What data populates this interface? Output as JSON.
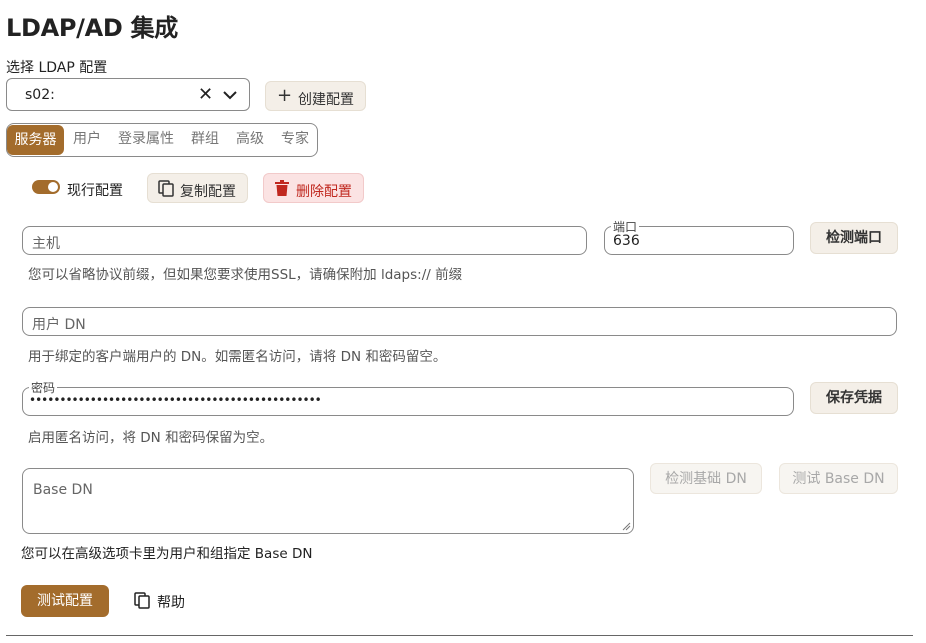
{
  "page": {
    "title": "LDAP/AD 集成"
  },
  "config_select": {
    "label": "选择 LDAP 配置",
    "value": "s02:",
    "clear_icon": "close-icon",
    "dropdown_icon": "chevron-down-icon"
  },
  "create_button": {
    "label": "创建配置",
    "icon": "plus-icon"
  },
  "tabs": [
    {
      "label": "服务器",
      "active": true
    },
    {
      "label": "用户",
      "active": false
    },
    {
      "label": "登录属性",
      "active": false
    },
    {
      "label": "群组",
      "active": false
    },
    {
      "label": "高级",
      "active": false
    },
    {
      "label": "专家",
      "active": false
    }
  ],
  "config_actions": {
    "active_toggle": {
      "label": "现行配置",
      "on": true
    },
    "copy": {
      "label": "复制配置",
      "icon": "copy-icon"
    },
    "delete": {
      "label": "删除配置",
      "icon": "trash-icon"
    }
  },
  "server": {
    "host": {
      "placeholder": "主机",
      "value": ""
    },
    "port": {
      "legend": "端口",
      "value": "636"
    },
    "detect_port": "检测端口",
    "host_help": "您可以省略协议前缀，但如果您要求使用SSL，请确保附加 ldaps:// 前缀"
  },
  "user_dn": {
    "placeholder": "用户 DN",
    "value": "",
    "help": "用于绑定的客户端用户的 DN。如需匿名访问，请将 DN 和密码留空。"
  },
  "password": {
    "legend": "密码",
    "value": "••••••••••••••••••••••••••••••••••••••••••••••••",
    "save": "保存凭据",
    "help": "启用匿名访问，将 DN 和密码保留为空。"
  },
  "base_dn": {
    "placeholder": "Base DN",
    "value": "",
    "detect": "检测基础 DN",
    "test": "测试 Base DN",
    "help": "您可以在高级选项卡里为用户和组指定 Base DN"
  },
  "footer": {
    "test_config": "测试配置",
    "help": "帮助",
    "help_icon": "copy-icon"
  },
  "colors": {
    "accent": "#a36c2c",
    "danger": "#c0281f",
    "danger_bg": "#fbe3e3",
    "button_bg": "#f4efe8"
  }
}
